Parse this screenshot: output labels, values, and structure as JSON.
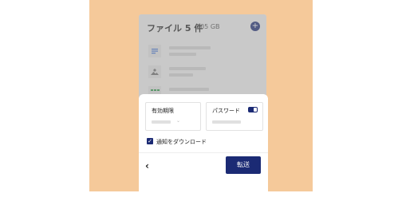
{
  "files_panel": {
    "title": "ファイル 5 件",
    "total_size": "105 GB",
    "add_icon": "plus-icon",
    "files": [
      {
        "icon": "document-icon",
        "icon_color": "#3b6fd6"
      },
      {
        "icon": "image-icon",
        "icon_color": "#6e6e6e"
      },
      {
        "icon": "spreadsheet-icon",
        "icon_color": "#2e9b4a"
      }
    ]
  },
  "transfer_sheet": {
    "expiry_label": "有効期限",
    "password_label": "パスワード",
    "password_toggle_on": true,
    "download_notify_label": "通知をダウンロード",
    "download_notify_checked": true,
    "back_icon": "chevron-left-icon",
    "send_label": "転送"
  },
  "colors": {
    "background": "#f5c99a",
    "accent": "#1b2a74"
  }
}
